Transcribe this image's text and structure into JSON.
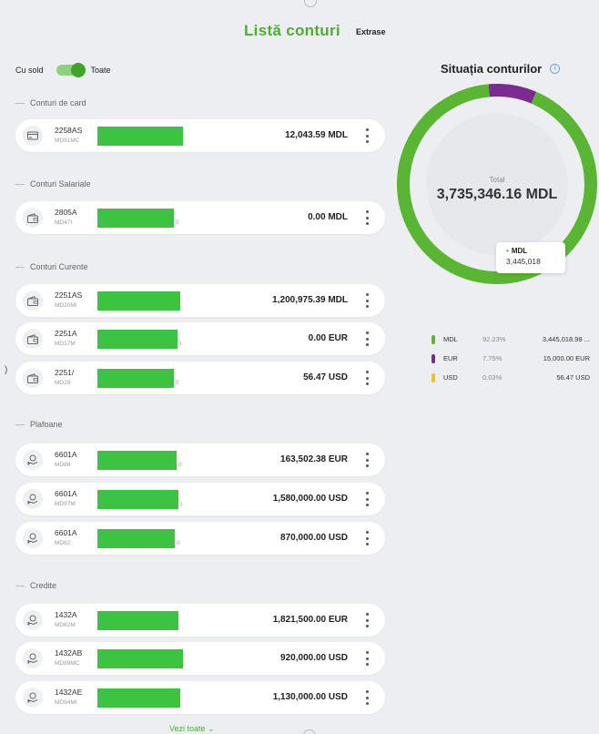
{
  "header": {
    "title": "Listă conturi",
    "extrase_label": "Extrase"
  },
  "toggle": {
    "left_label": "Cu sold",
    "right_label": "Toate"
  },
  "sections": [
    {
      "title": "Conturi de card"
    },
    {
      "title": "Conturi Salariale"
    },
    {
      "title": "Conturi Curente"
    },
    {
      "title": "Plafoane"
    },
    {
      "title": "Credite"
    }
  ],
  "accounts": [
    {
      "name": "2258AS",
      "iban": "MD91MC",
      "iban_tail": "",
      "amount": "12,043.59 MDL",
      "icon": "card-icon"
    },
    {
      "name": "2805A",
      "iban": "MD47I",
      "iban_tail": "0",
      "amount": "0.00 MDL",
      "icon": "wallet-icon"
    },
    {
      "name": "2251AS",
      "iban": "MD20MI",
      "iban_tail": "",
      "amount": "1,200,975.39 MDL",
      "icon": "wallet-icon"
    },
    {
      "name": "2251A",
      "iban": "MD17M",
      "iban_tail": ")",
      "amount": "0.00 EUR",
      "icon": "wallet-icon"
    },
    {
      "name": "2251/",
      "iban": "MD29",
      "iban_tail": "0",
      "amount": "56.47 USD",
      "icon": "wallet-icon"
    },
    {
      "name": "6601A",
      "iban": "MD88",
      "iban_tail": "0",
      "amount": "163,502.38 EUR",
      "icon": "coin-hand-icon"
    },
    {
      "name": "6601A",
      "iban": "MD97M",
      "iban_tail": ")",
      "amount": "1,580,000.00 USD",
      "icon": "coin-hand-icon"
    },
    {
      "name": "6601A",
      "iban": "MD62",
      "iban_tail": "0",
      "amount": "870,000.00 USD",
      "icon": "coin-hand-icon"
    },
    {
      "name": "1432A",
      "iban": "MD62M",
      "iban_tail": "",
      "amount": "1,821,500.00 EUR",
      "icon": "coin-hand-icon"
    },
    {
      "name": "1432AB",
      "iban": "MD89MC",
      "iban_tail": "",
      "amount": "920,000.00 USD",
      "icon": "coin-hand-icon"
    },
    {
      "name": "1432AE",
      "iban": "MD94MI",
      "iban_tail": "",
      "amount": "1,130,000.00 USD",
      "icon": "coin-hand-icon"
    }
  ],
  "vezi_toate": "Vezi toate",
  "summary": {
    "title": "Situația conturilor",
    "total_label": "Total",
    "total_value": "3,735,346.16 MDL",
    "tooltip_currency": "MDL",
    "tooltip_value": "3,445,018",
    "legend": [
      {
        "currency": "MDL",
        "percent": "92.23%",
        "value": "3,445,018.98 ...",
        "color": "#5ab532"
      },
      {
        "currency": "EUR",
        "percent": "7.75%",
        "value": "15,000.00 EUR",
        "color": "#7b2a8f"
      },
      {
        "currency": "USD",
        "percent": "0.03%",
        "value": "56.47 USD",
        "color": "#f3c12b"
      }
    ]
  },
  "colors": {
    "accent": "#4caf32",
    "mask": "#3cc341"
  }
}
